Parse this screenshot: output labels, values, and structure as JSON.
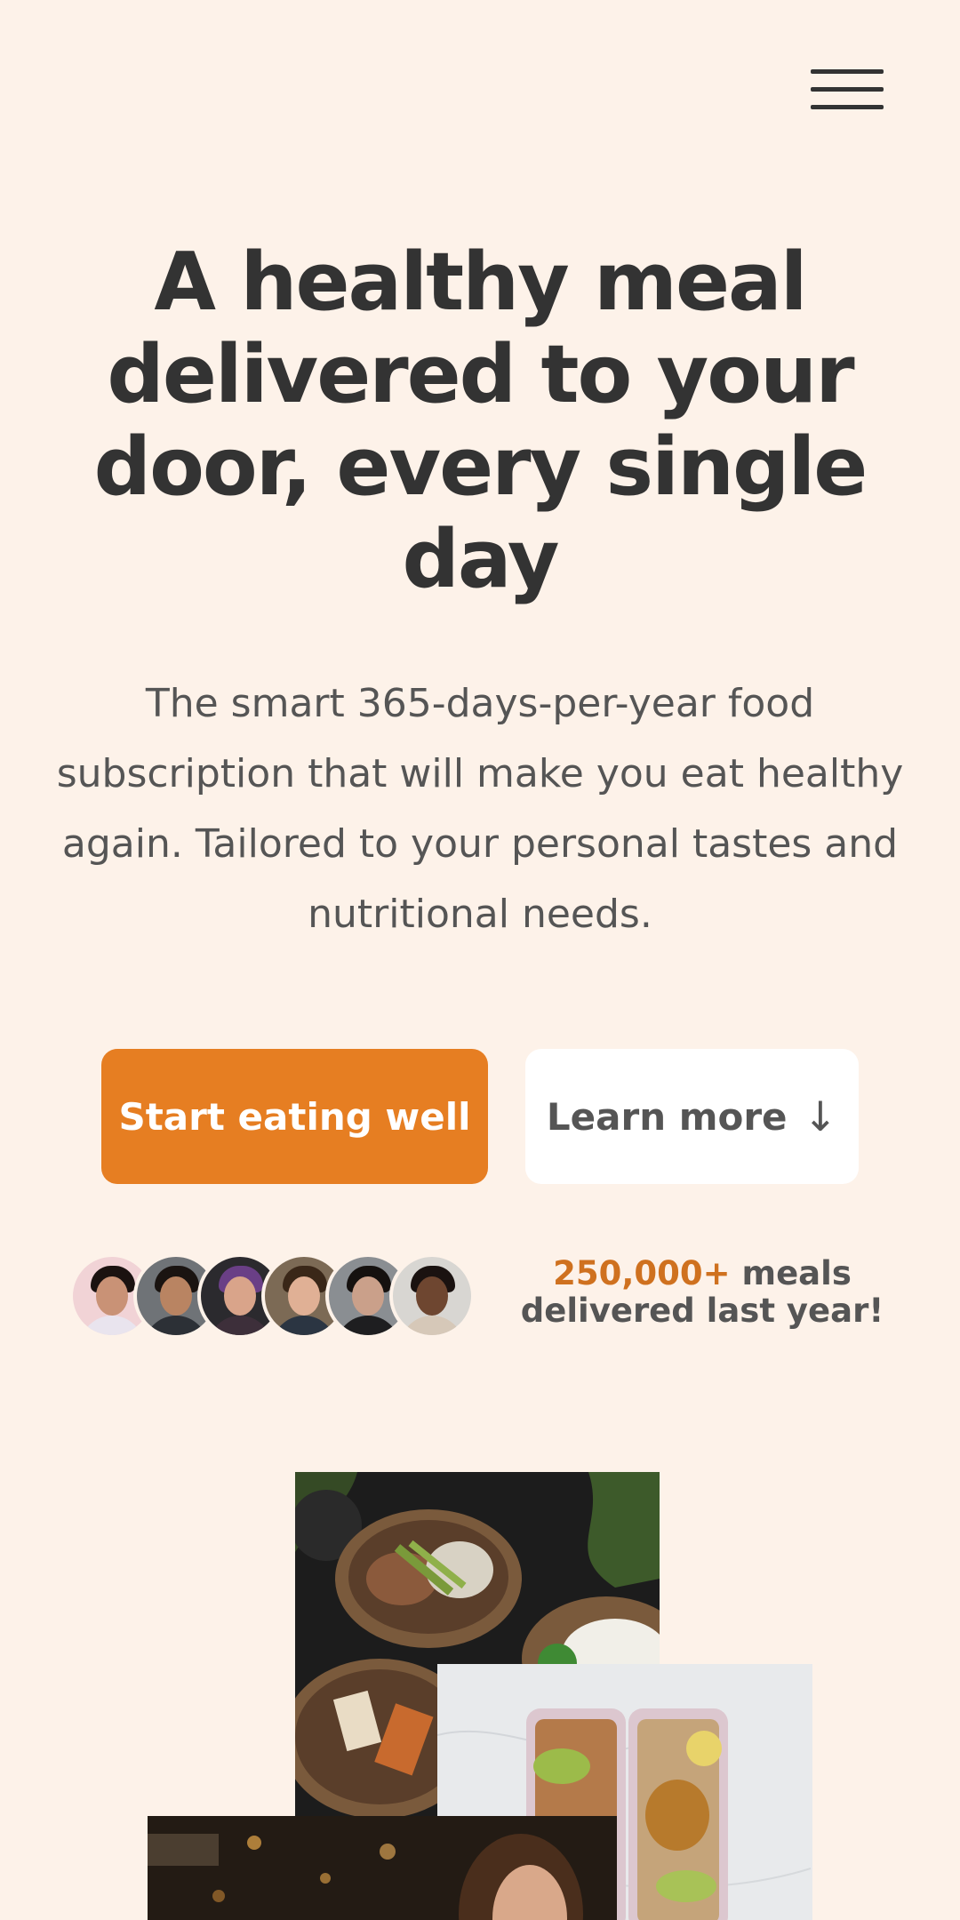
{
  "header": {
    "menu_icon": "hamburger-menu-icon"
  },
  "hero": {
    "title": "A healthy meal delivered to your door, every single day",
    "description": "The smart 365-days-per-year food subscription that will make you eat healthy again. Tailored to your personal tastes and nutritional needs.",
    "primary_button": "Start eating well",
    "secondary_button": "Learn more",
    "secondary_button_icon": "arrow-down-icon",
    "secondary_button_arrow": "↓"
  },
  "delivered": {
    "count": "250,000+",
    "text": " meals delivered last year!",
    "avatars": [
      {
        "name": "customer-avatar-1"
      },
      {
        "name": "customer-avatar-2"
      },
      {
        "name": "customer-avatar-3"
      },
      {
        "name": "customer-avatar-4"
      },
      {
        "name": "customer-avatar-5"
      },
      {
        "name": "customer-avatar-6"
      }
    ]
  },
  "colors": {
    "background": "#fdf2e9",
    "primary": "#e67e22",
    "heading": "#333333",
    "text": "#555555",
    "accent_text": "#cf711f"
  }
}
